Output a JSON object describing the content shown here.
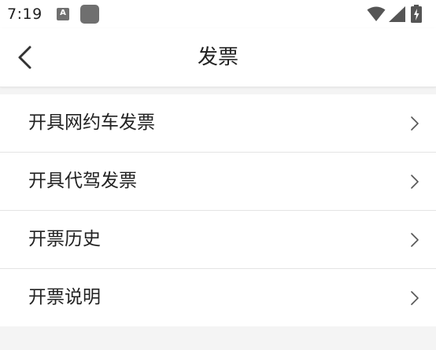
{
  "status_bar": {
    "time": "7:19",
    "notification_icon_letter": "A",
    "icons": [
      "a-notification-icon",
      "app-notification-icon",
      "wifi-icon",
      "cellular-signal-icon",
      "battery-charging-icon"
    ]
  },
  "header": {
    "title": "发票",
    "back_icon": "back-arrow-icon"
  },
  "menu": {
    "items": [
      {
        "label": "开具网约车发票",
        "icon": "chevron-right-icon"
      },
      {
        "label": "开具代驾发票",
        "icon": "chevron-right-icon"
      },
      {
        "label": "开票历史",
        "icon": "chevron-right-icon"
      },
      {
        "label": "开票说明",
        "icon": "chevron-right-icon"
      }
    ]
  },
  "colors": {
    "background": "#f4f4f4",
    "surface": "#ffffff",
    "text": "#222222",
    "divider": "#e4e4e4",
    "chevron": "#555555"
  }
}
